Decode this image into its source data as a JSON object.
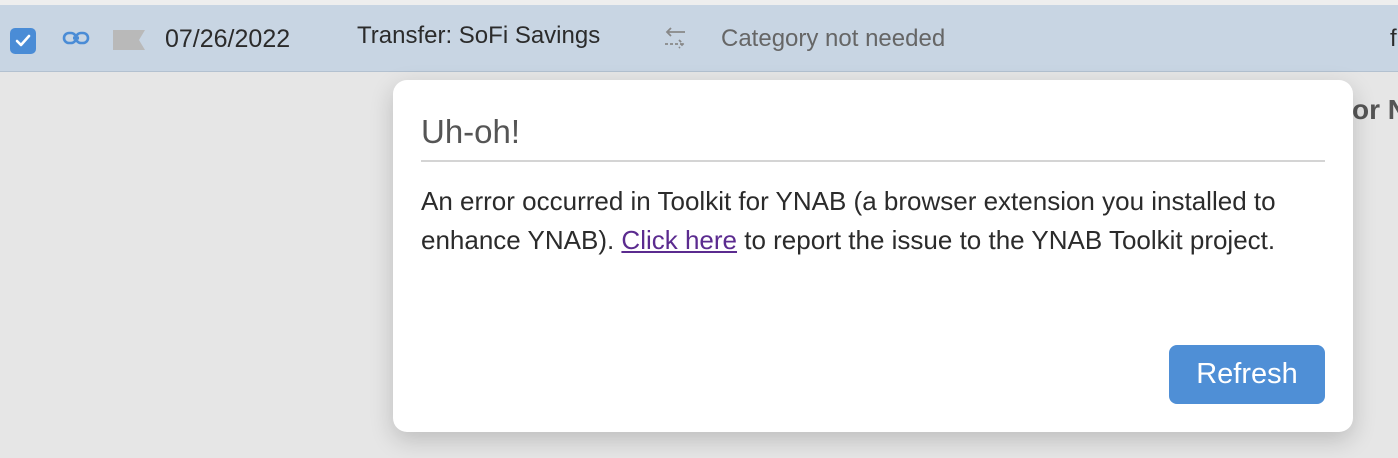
{
  "row": {
    "date": "07/26/2022",
    "payee": "Transfer: SoFi Savings",
    "category": "Category not needed",
    "right_clip": "f"
  },
  "background_text": "or N",
  "modal": {
    "title": "Uh-oh!",
    "body_before": "An error occurred in Toolkit for YNAB (a browser extension you installed to enhance YNAB). ",
    "link_text": "Click here",
    "body_after": " to report the issue to the YNAB Toolkit project.",
    "refresh_label": "Refresh"
  },
  "icons": [
    "checkbox-checked-icon",
    "link-icon",
    "flag-icon",
    "transfer-icon"
  ],
  "colors": {
    "row_bg": "#c8d5e3",
    "accent": "#4a8cd6",
    "link": "#5b2b8f",
    "button": "#4f8fd6"
  }
}
